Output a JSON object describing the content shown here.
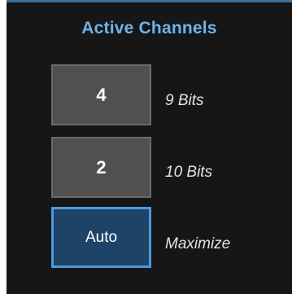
{
  "panel": {
    "title": "Active Channels",
    "options": [
      {
        "button": "4",
        "description": "9 Bits",
        "selected": false
      },
      {
        "button": "2",
        "description": "10 Bits",
        "selected": false
      },
      {
        "button": "Auto",
        "description": "Maximize",
        "selected": true
      }
    ],
    "colors": {
      "title": "#6fb3e8",
      "background": "#161616",
      "button": "#505050",
      "selected_button": "#1f4366",
      "selected_border": "#4b9be0"
    }
  }
}
